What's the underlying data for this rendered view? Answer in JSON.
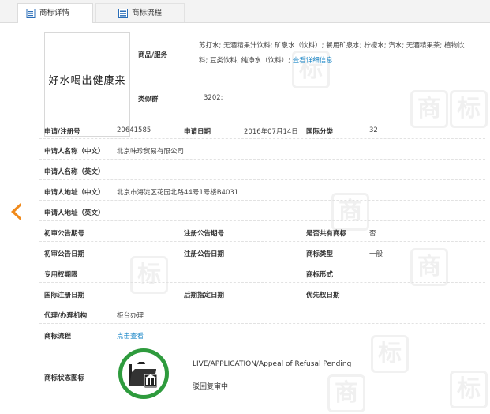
{
  "tabs": [
    {
      "label": "商标详情",
      "icon": "document-icon",
      "active": true
    },
    {
      "label": "商标流程",
      "icon": "list-icon",
      "active": false
    }
  ],
  "logo": {
    "text": "好水喝出健康来"
  },
  "goods": {
    "label": "商品/服务",
    "value": "苏打水; 无酒精果汁饮料; 矿泉水（饮料）; 餐用矿泉水; 柠檬水; 汽水; 无酒精果茶; 植物饮料; 豆类饮料; 纯净水（饮料）;",
    "link": "查看详细信息"
  },
  "similar_group": {
    "label": "类似群",
    "value": "3202;"
  },
  "rows": {
    "reg_no_label": "申请/注册号",
    "reg_no": "20641585",
    "apply_date_label": "申请日期",
    "apply_date": "2016年07月14日",
    "intl_class_label": "国际分类",
    "intl_class": "32",
    "applicant_cn_label": "申请人名称（中文）",
    "applicant_cn": "北京味珍贸易有限公司",
    "applicant_en_label": "申请人名称（英文）",
    "address_cn_label": "申请人地址（中文）",
    "address_cn": "北京市海淀区花园北路44号1号楼B4031",
    "address_en_label": "申请人地址（英文）",
    "prelim_no_label": "初审公告期号",
    "reg_pub_no_label": "注册公告期号",
    "shared_label": "是否共有商标",
    "shared": "否",
    "prelim_date_label": "初审公告日期",
    "reg_pub_date_label": "注册公告日期",
    "tm_type_label": "商标类型",
    "tm_type": "一般",
    "exclusive_label": "专用权期限",
    "tm_form_label": "商标形式",
    "intl_reg_date_label": "国际注册日期",
    "later_date_label": "后期指定日期",
    "priority_label": "优先权日期",
    "agent_label": "代理/办理机构",
    "agent": "柜台办理",
    "process_label": "商标流程",
    "process_link": "点击查看",
    "status_icon_label": "商标状态图标",
    "status_en": "LIVE/APPLICATION/Appeal of Refusal Pending",
    "status_cn": "驳回复审中"
  },
  "watermark_chars": [
    "标",
    "商",
    "标",
    "商",
    "标",
    "商",
    "标",
    "商",
    "标"
  ],
  "colors": {
    "accent": "#1e88c8",
    "arrow": "#f08a1c",
    "status_ring": "#2e9b3d"
  }
}
